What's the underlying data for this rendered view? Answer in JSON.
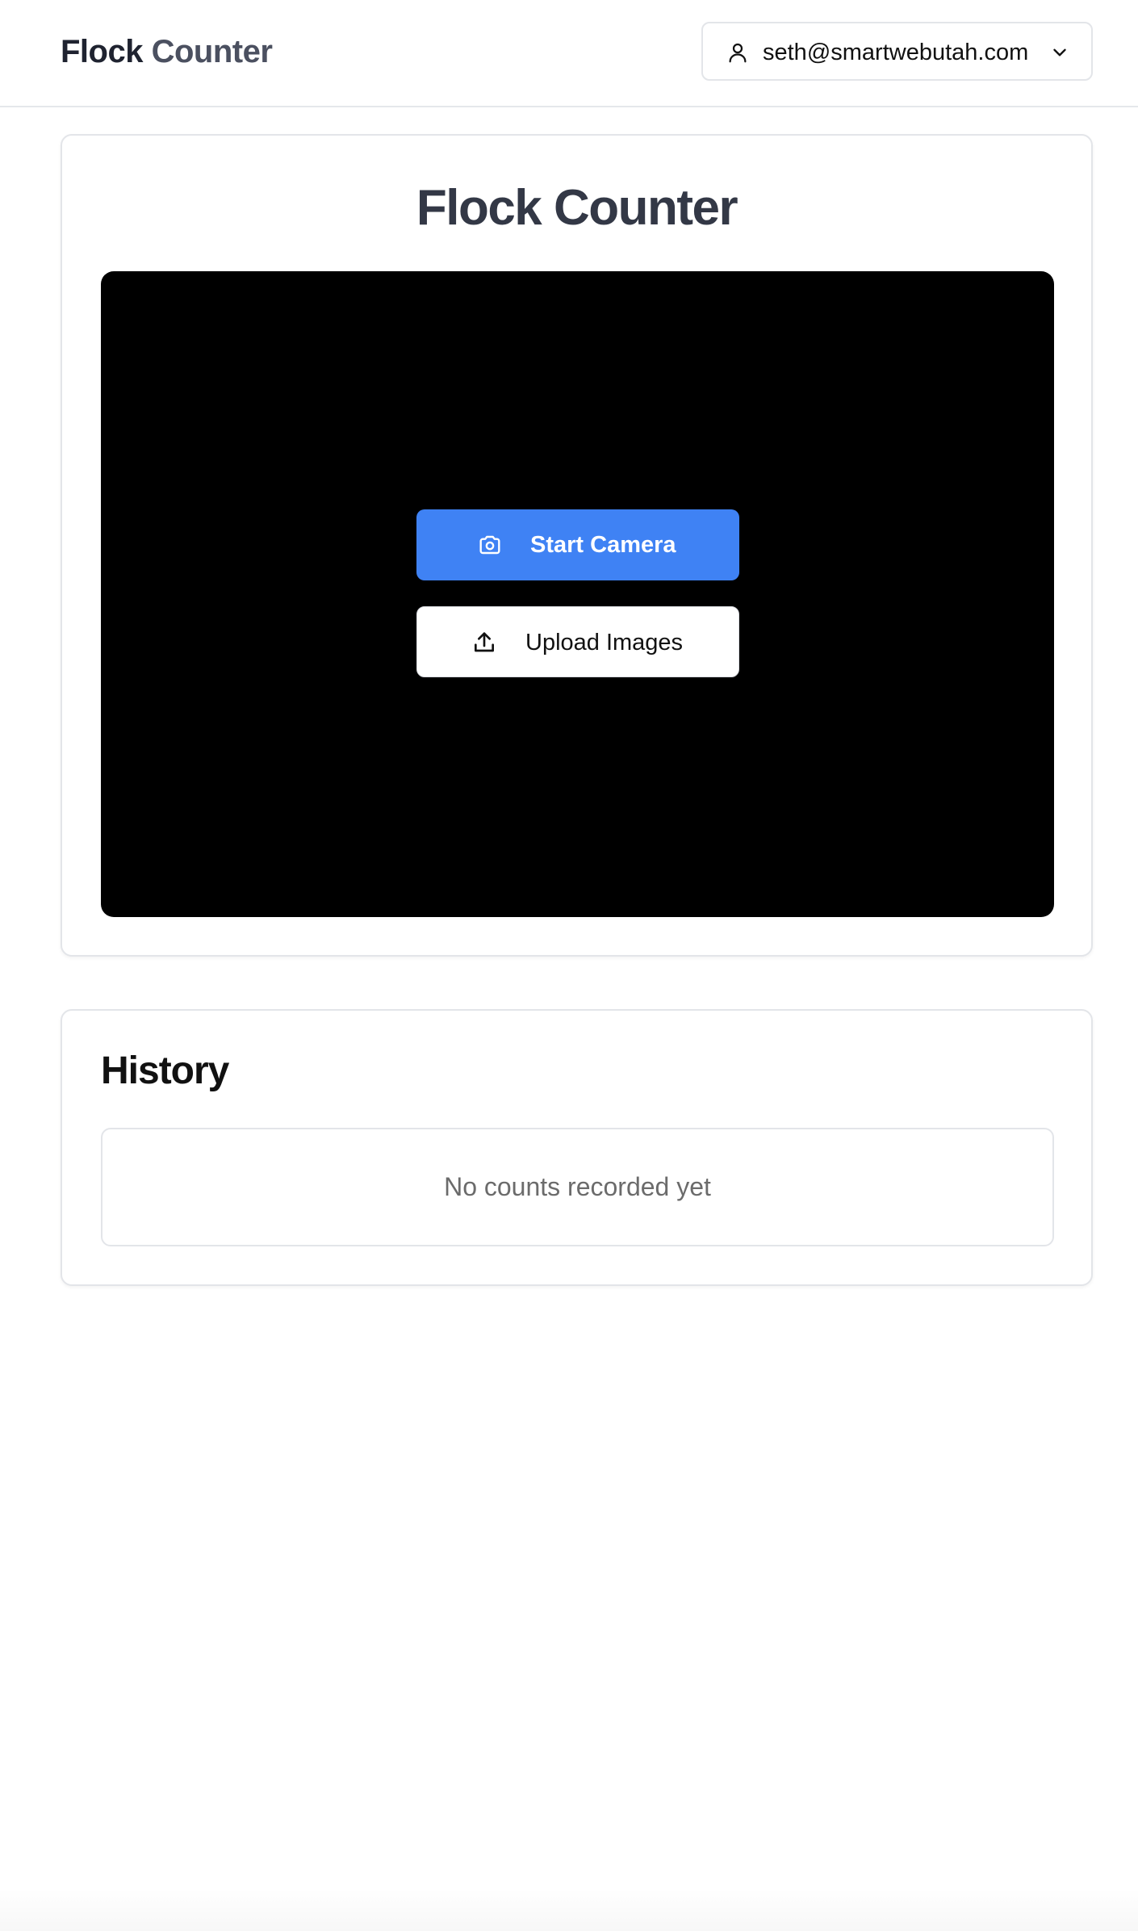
{
  "header": {
    "brand_part_1": "Flock",
    "brand_part_2": "Counter",
    "user_email": "seth@smartwebutah.com",
    "user_icon": "user-icon",
    "menu_icon": "chevron-down-icon"
  },
  "main": {
    "title": "Flock Counter",
    "start_camera_label": "Start Camera",
    "start_camera_icon": "camera-icon",
    "upload_images_label": "Upload Images",
    "upload_images_icon": "upload-icon"
  },
  "history": {
    "title": "History",
    "empty_message": "No counts recorded yet"
  },
  "colors": {
    "accent": "#3f82f4",
    "camera_background": "#000000",
    "heading": "#333846",
    "muted_text": "#6b6b6b"
  }
}
